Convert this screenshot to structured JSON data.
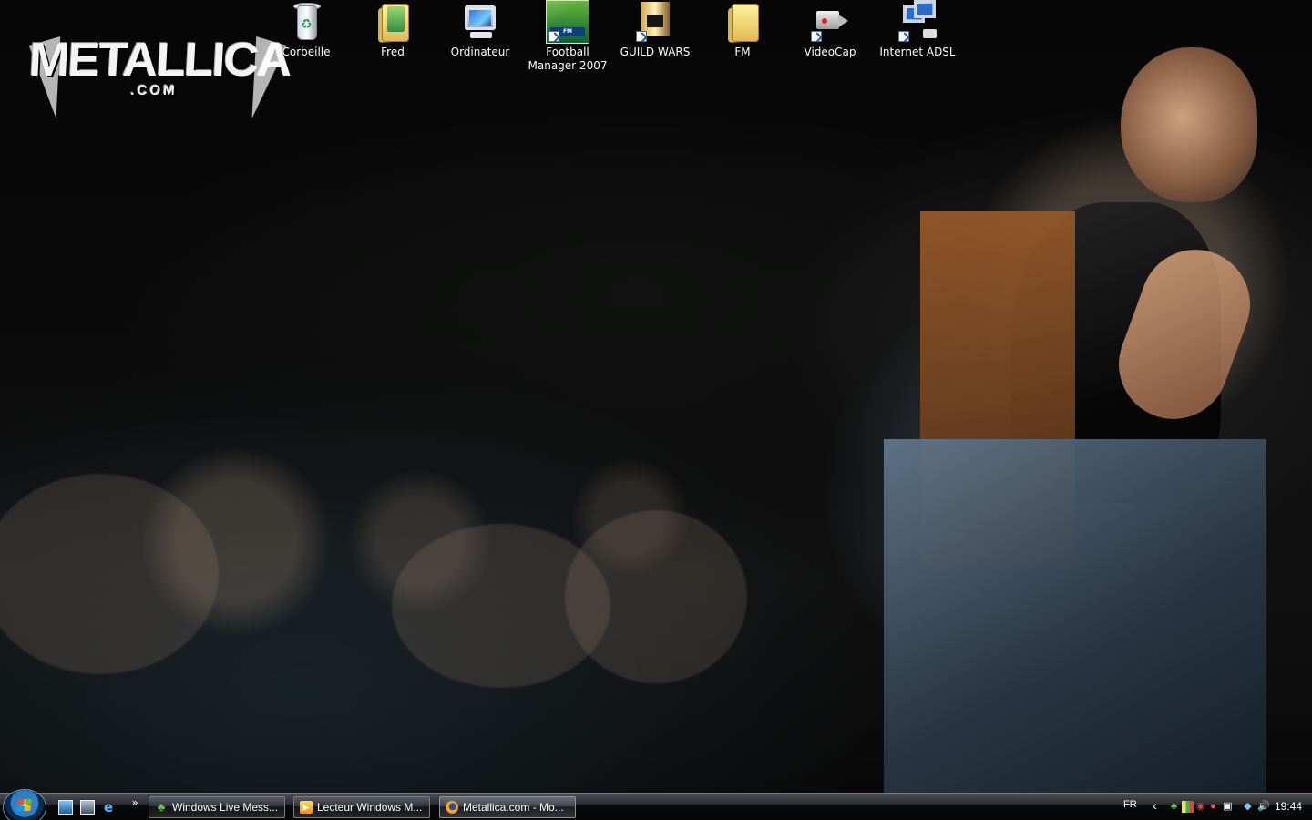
{
  "desktop": {
    "logo": {
      "main": "METALLICA",
      "sub": ".COM"
    },
    "icons": [
      {
        "label": "Corbeille",
        "icon": "recycle-bin-icon"
      },
      {
        "label": "Fred",
        "icon": "folder-icon"
      },
      {
        "label": "Ordinateur",
        "icon": "computer-icon"
      },
      {
        "label": "Football Manager 2007",
        "icon": "football-manager-icon"
      },
      {
        "label": "GUILD WARS",
        "icon": "guild-wars-icon"
      },
      {
        "label": "FM",
        "icon": "folder-icon"
      },
      {
        "label": "VideoCap",
        "icon": "video-camera-icon"
      },
      {
        "label": "Internet ADSL",
        "icon": "network-icon"
      }
    ]
  },
  "taskbar": {
    "quick_launch": {
      "more": "»"
    },
    "tasks": [
      {
        "label": "Windows Live Mess...",
        "icon": "messenger-icon"
      },
      {
        "label": "Lecteur Windows M...",
        "icon": "media-player-icon"
      },
      {
        "label": "Metallica.com - Mo...",
        "icon": "firefox-icon"
      }
    ],
    "tray": {
      "language": "FR",
      "time": "19:44"
    }
  },
  "colors": {
    "taskbar_top": "#4b4e53",
    "taskbar_bottom": "#050505",
    "desktop_text": "#ffffff",
    "start_blue": "#2b80c9"
  }
}
